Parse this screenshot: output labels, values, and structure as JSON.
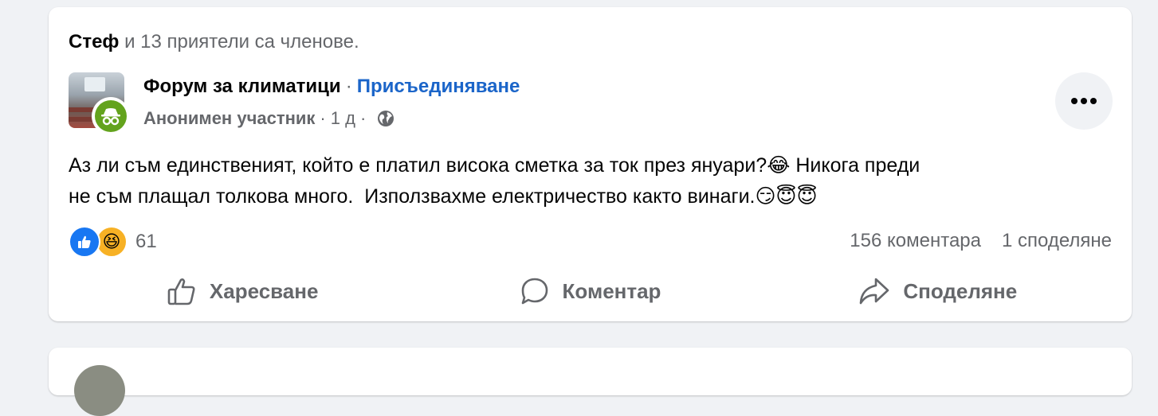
{
  "context": {
    "name": "Стеф",
    "rest": " и 13 приятели са членове."
  },
  "group": {
    "name": "Форум за климатици",
    "separator": "·",
    "join_label": "Присъединяване"
  },
  "meta": {
    "author": "Анонимен участник",
    "dot": "·",
    "time": "1 д"
  },
  "post": {
    "line1": "Аз ли съм единственият, който е платил висока сметка за ток през януари?😂 Никога преди",
    "line2": "не съм плащал толкова много.  Използвахме електричество както винаги.😏😇😇"
  },
  "reactions": {
    "count": "61",
    "icons": [
      "like-icon",
      "haha-icon"
    ]
  },
  "stats": {
    "comments": "156 коментара",
    "shares": "1 споделяне"
  },
  "actions": {
    "like": "Харесване",
    "comment": "Коментар",
    "share": "Споделяне"
  },
  "colors": {
    "link": "#1b65c9",
    "like": "#1877f2",
    "secondary": "#65676b",
    "anon": "#63a31d"
  }
}
